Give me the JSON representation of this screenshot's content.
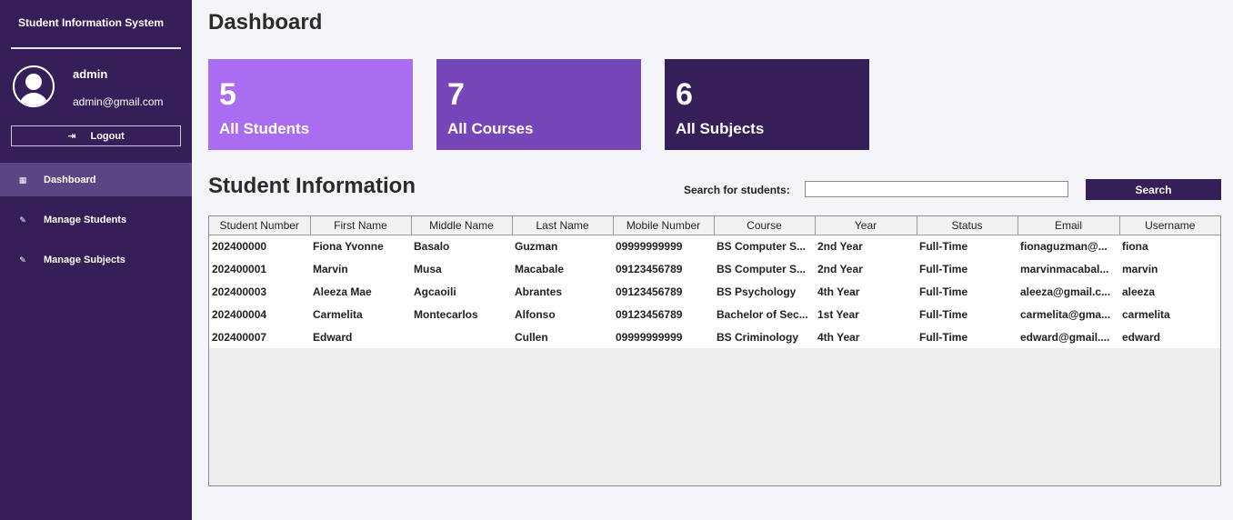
{
  "sidebar": {
    "app_title": "Student Information System",
    "user": {
      "name": "admin",
      "email": "admin@gmail.com"
    },
    "logout_label": "Logout",
    "nav": [
      {
        "label": "Dashboard",
        "active": true
      },
      {
        "label": "Manage Students",
        "active": false
      },
      {
        "label": "Manage Subjects",
        "active": false
      }
    ]
  },
  "main": {
    "title": "Dashboard",
    "cards": [
      {
        "count": "5",
        "label": "All Students",
        "color": "#aa6cf0"
      },
      {
        "count": "7",
        "label": "All Courses",
        "color": "#7646b9"
      },
      {
        "count": "6",
        "label": "All Subjects",
        "color": "#361e59"
      }
    ],
    "section_title": "Student Information",
    "search": {
      "label": "Search for students:",
      "value": "",
      "placeholder": "",
      "button": "Search"
    },
    "table": {
      "columns": [
        "Student Number",
        "First Name",
        "Middle Name",
        "Last Name",
        "Mobile Number",
        "Course",
        "Year",
        "Status",
        "Email",
        "Username"
      ],
      "rows": [
        [
          "202400000",
          "Fiona Yvonne",
          "Basalo",
          "Guzman",
          "09999999999",
          "BS Computer S...",
          "2nd Year",
          "Full-Time",
          "fionaguzman@...",
          "fiona"
        ],
        [
          "202400001",
          "Marvin",
          "Musa",
          "Macabale",
          "09123456789",
          "BS Computer S...",
          "2nd Year",
          "Full-Time",
          "marvinmacabal...",
          "marvin"
        ],
        [
          "202400003",
          "Aleeza Mae",
          "Agcaoili",
          "Abrantes",
          "09123456789",
          "BS Psychology",
          "4th Year",
          "Full-Time",
          "aleeza@gmail.c...",
          "aleeza"
        ],
        [
          "202400004",
          "Carmelita",
          "Montecarlos",
          "Alfonso",
          "09123456789",
          "Bachelor of Sec...",
          "1st Year",
          "Full-Time",
          "carmelita@gma...",
          "carmelita"
        ],
        [
          "202400007",
          "Edward",
          "",
          "Cullen",
          "09999999999",
          "BS Criminology",
          "4th Year",
          "Full-Time",
          "edward@gmail....",
          "edward"
        ]
      ]
    }
  }
}
